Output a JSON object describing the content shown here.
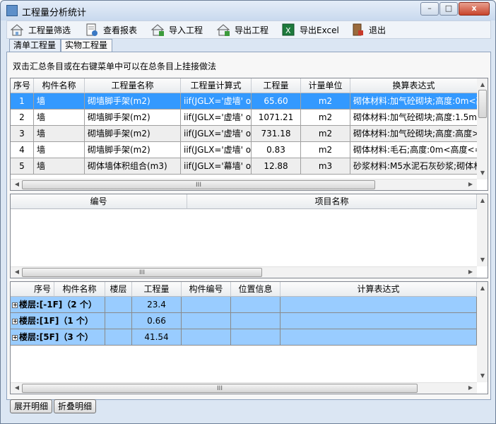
{
  "window": {
    "title": "工程量分析统计",
    "controls": {
      "minimize": "–",
      "maximize": "□",
      "close": "x"
    }
  },
  "toolbar": [
    {
      "label": "工程量筛选",
      "icon": "house-filter-icon"
    },
    {
      "label": "查看报表",
      "icon": "report-icon"
    },
    {
      "label": "导入工程",
      "icon": "import-house-icon"
    },
    {
      "label": "导出工程",
      "icon": "export-house-icon"
    },
    {
      "label": "导出Excel",
      "icon": "excel-icon"
    },
    {
      "label": "退出",
      "icon": "exit-door-icon"
    }
  ],
  "tabs": [
    {
      "label": "清单工程量",
      "active": false
    },
    {
      "label": "实物工程量",
      "active": true
    }
  ],
  "hint": "双击汇总条目或在右键菜单中可以在总条目上挂接做法",
  "top_table": {
    "headers": [
      "序号",
      "构件名称",
      "工程量名称",
      "工程量计算式",
      "工程量",
      "计量单位",
      "换算表达式"
    ],
    "rows": [
      [
        "1",
        "墙",
        "砌墙脚手架(m2)",
        "iif(JGLX='虚墙' o",
        "65.60",
        "m2",
        "砌体材料:加气砼砌块;高度:0m<高"
      ],
      [
        "2",
        "墙",
        "砌墙脚手架(m2)",
        "iif(JGLX='虚墙' o",
        "1071.21",
        "m2",
        "砌体材料:加气砼砌块;高度:1.5m<"
      ],
      [
        "3",
        "墙",
        "砌墙脚手架(m2)",
        "iif(JGLX='虚墙' o",
        "731.18",
        "m2",
        "砌体材料:加气砼砌块;高度:高度>"
      ],
      [
        "4",
        "墙",
        "砌墙脚手架(m2)",
        "iif(JGLX='虚墙' o",
        "0.83",
        "m2",
        "砌体材料:毛石;高度:0m<高度<="
      ],
      [
        "5",
        "墙",
        "砌体墙体积组合(m3)",
        "iif(JGLX='幕墙' o",
        "12.88",
        "m3",
        "砂浆材料:M5水泥石灰砂浆;砌体材"
      ]
    ],
    "selected_row": 0
  },
  "mid_table": {
    "headers": [
      "编号",
      "项目名称"
    ]
  },
  "bottom_table": {
    "headers": [
      "序号",
      "构件名称",
      "楼层",
      "工程量",
      "构件编号",
      "位置信息",
      "计算表达式"
    ],
    "groups": [
      {
        "label": "楼层:[-1F]（2 个）",
        "qty": "23.4"
      },
      {
        "label": "楼层:[1F]（1 个）",
        "qty": "0.66"
      },
      {
        "label": "楼层:[5F]（3 个）",
        "qty": "41.54"
      }
    ]
  },
  "buttons": {
    "expand": "展开明细",
    "collapse": "折叠明细"
  },
  "scroll_glyph": "III",
  "colors": {
    "selection": "#3399ff",
    "group_row": "#99ccff",
    "window_frame": "#dbe6f3"
  }
}
